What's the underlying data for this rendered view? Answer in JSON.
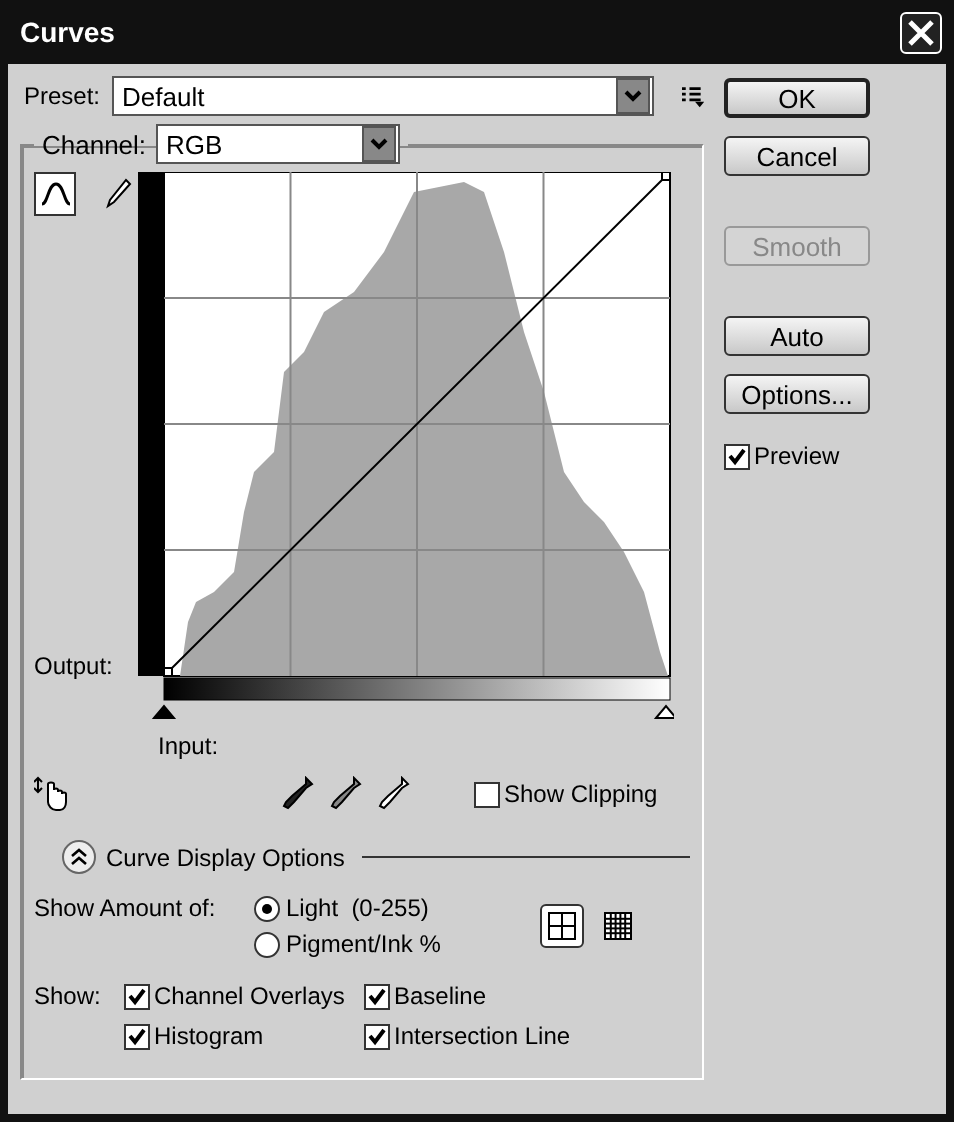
{
  "window": {
    "title": "Curves"
  },
  "preset": {
    "label": "Preset:",
    "value": "Default"
  },
  "channel": {
    "label": "Channel:",
    "value": "RGB"
  },
  "tools": [
    {
      "kind": "curve",
      "selected": true
    },
    {
      "kind": "pencil",
      "selected": false
    }
  ],
  "graph": {
    "output_label": "Output:",
    "input_label": "Input:"
  },
  "show_clipping": {
    "label": "Show Clipping",
    "checked": false
  },
  "curve_display_options": {
    "label": "Curve Display Options",
    "expanded": true
  },
  "show_amount": {
    "label": "Show Amount of:",
    "options": [
      {
        "label": "Light  (0-255)",
        "selected": true
      },
      {
        "label": "Pigment/Ink %",
        "selected": false
      }
    ]
  },
  "grid_size": [
    {
      "kind": "simple",
      "selected": true
    },
    {
      "kind": "detailed",
      "selected": false
    }
  ],
  "show": {
    "label": "Show:",
    "options": [
      {
        "label": "Channel Overlays",
        "checked": true
      },
      {
        "label": "Baseline",
        "checked": true
      },
      {
        "label": "Histogram",
        "checked": true
      },
      {
        "label": "Intersection Line",
        "checked": true
      }
    ]
  },
  "buttons": [
    {
      "label": "OK",
      "default": true,
      "disabled": false
    },
    {
      "label": "Cancel",
      "default": false,
      "disabled": false
    },
    {
      "label": "Smooth",
      "default": false,
      "disabled": true
    },
    {
      "label": "Auto",
      "default": false,
      "disabled": false
    },
    {
      "label": "Options...",
      "default": false,
      "disabled": false
    }
  ],
  "preview": {
    "label": "Preview",
    "checked": true
  }
}
